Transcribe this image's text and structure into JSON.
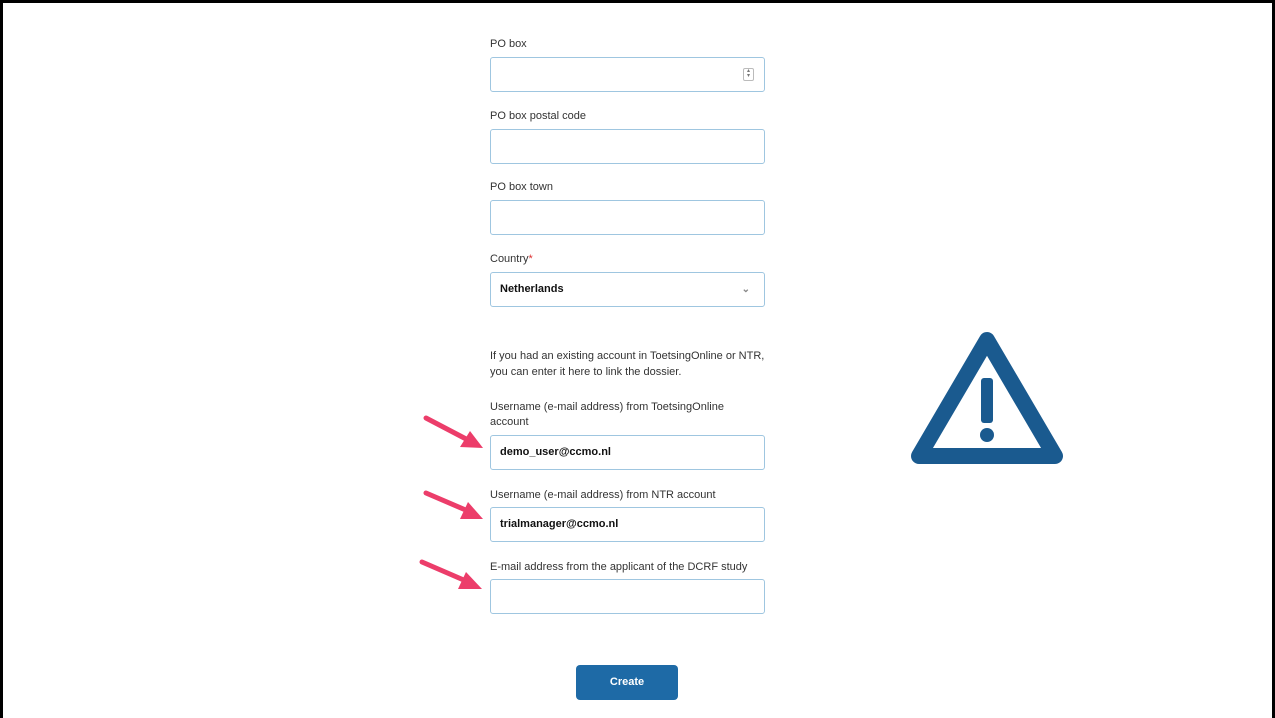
{
  "form": {
    "po_box": {
      "label": "PO box",
      "value": ""
    },
    "po_box_postal_code": {
      "label": "PO box postal code",
      "value": ""
    },
    "po_box_town": {
      "label": "PO box town",
      "value": ""
    },
    "country": {
      "label": "Country",
      "required_mark": "*",
      "value": "Netherlands"
    },
    "info_text": "If you had an existing account in ToetsingOnline or NTR, you can enter it here to link the dossier.",
    "toetsing_username": {
      "label": "Username (e-mail address) from ToetsingOnline account",
      "value": "demo_user@ccmo.nl"
    },
    "ntr_username": {
      "label": "Username (e-mail address) from NTR account",
      "value": "trialmanager@ccmo.nl"
    },
    "dcrf_email": {
      "label": "E-mail address from the applicant of the DCRF study",
      "value": ""
    },
    "create_label": "Create"
  },
  "icons": {
    "arrows": "arrow-pointer-icon",
    "warning": "warning-triangle-icon",
    "spinner": "number-spinner-icon",
    "chevron": "chevron-down-icon"
  },
  "colors": {
    "accent": "#1e6aa6",
    "warning": "#1a5a8f",
    "arrow": "#ec3d6a",
    "required": "#dd3333",
    "field_border": "#9fc6e0"
  }
}
